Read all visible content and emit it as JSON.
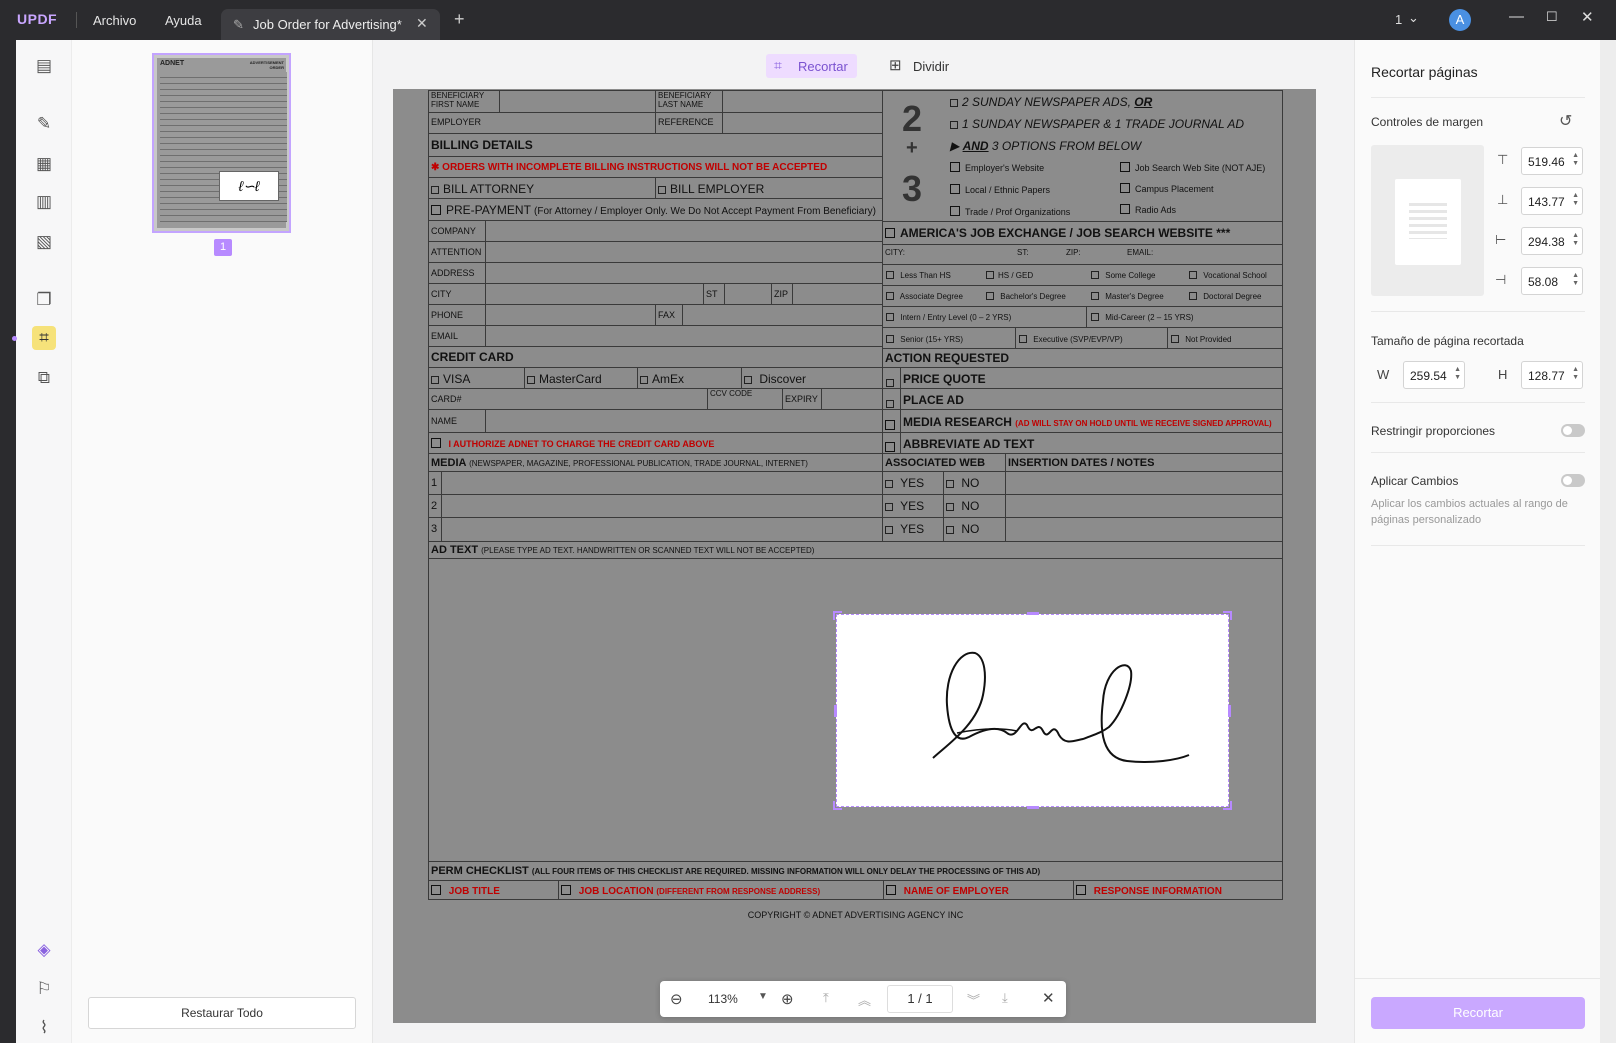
{
  "app": {
    "logo": "UPDF",
    "menu_file": "Archivo",
    "menu_help": "Ayuda",
    "tab_title": "Job Order for Advertising*",
    "page_indicator": "1",
    "avatar": "A"
  },
  "toolbar": {
    "crop_label": "Recortar",
    "split_label": "Dividir"
  },
  "thumbs": {
    "page_number": "1",
    "restore_all": "Restaurar Todo"
  },
  "right": {
    "title": "Recortar páginas",
    "margin_controls": "Controles de margen",
    "top": "519.46",
    "bottom": "143.77",
    "left": "294.38",
    "right": "58.08",
    "size_title": "Tamaño de página recortada",
    "w_label": "W",
    "w_value": "259.54",
    "h_label": "H",
    "h_value": "128.77",
    "lock_ratio": "Restringir proporciones",
    "apply_changes": "Aplicar Cambios",
    "apply_desc": "Aplicar los cambios actuales al rango de páginas personalizado",
    "crop_button": "Recortar"
  },
  "zoombar": {
    "zoom": "113%",
    "page": "1 / 1"
  },
  "form": {
    "beneficiary_first": "BENEFICIARY FIRST NAME",
    "beneficiary_last": "BENEFICIARY LAST NAME",
    "employer": "EMPLOYER",
    "reference": "REFERENCE",
    "billing_details": "BILLING DETAILS",
    "billing_warning": "ORDERS WITH INCOMPLETE BILLING INSTRUCTIONS WILL NOT BE ACCEPTED",
    "bill_attorney": "BILL ATTORNEY",
    "bill_employer": "BILL EMPLOYER",
    "prepayment": "PRE-PAYMENT",
    "prepayment_note": "(For Attorney / Employer Only. We Do Not Accept Payment From Beneficiary)",
    "company": "COMPANY",
    "attention": "ATTENTION",
    "address": "ADDRESS",
    "city": "CITY",
    "st": "ST",
    "zip": "ZIP",
    "phone": "PHONE",
    "fax": "FAX",
    "email": "EMAIL",
    "credit_card": "CREDIT CARD",
    "visa": "VISA",
    "mastercard": "MasterCard",
    "amex": "AmEx",
    "discover": "Discover",
    "card_no": "CARD#",
    "ccv": "CCV CODE",
    "expiry": "EXPIRY",
    "name": "NAME",
    "authorize": "I AUTHORIZE ADNET TO CHARGE THE CREDIT CARD ABOVE",
    "media": "MEDIA",
    "media_note": "(NEWSPAPER, MAGAZINE, PROFESSIONAL PUBLICATION, TRADE JOURNAL, INTERNET)",
    "row1": "1",
    "row2": "2",
    "row3": "3",
    "ad_text": "AD TEXT",
    "ad_text_note": "(PLEASE TYPE AD TEXT. HANDWRITTEN OR SCANNED TEXT WILL NOT BE ACCEPTED)",
    "big2": "2",
    "plus": "+",
    "big3": "3",
    "opt_sunday": "2 SUNDAY NEWSPAPER ADS,",
    "opt_or": "OR",
    "opt_sunday_trade": "1 SUNDAY NEWSPAPER & 1 TRADE JOURNAL AD",
    "opt_and": "AND",
    "opt_three": "3 OPTIONS FROM BELOW",
    "employers_website": "Employer's Website",
    "job_search": "Job Search Web Site (NOT AJE)",
    "local_ethnic": "Local / Ethnic Papers",
    "campus": "Campus Placement",
    "trade_prof": "Trade / Prof Organizations",
    "radio": "Radio Ads",
    "aje": "AMERICA'S JOB EXCHANGE / JOB SEARCH WEBSITE ***",
    "aje_city": "CITY:",
    "aje_st": "ST:",
    "aje_zip": "ZIP:",
    "aje_email": "EMAIL:",
    "less_hs": "Less Than HS",
    "hs_ged": "HS / GED",
    "some_college": "Some College",
    "vocational": "Vocational School",
    "associate": "Associate Degree",
    "bachelor": "Bachelor's Degree",
    "master": "Master's Degree",
    "doctoral": "Doctoral Degree",
    "intern": "Intern / Entry Level (0 – 2 YRS)",
    "mid": "Mid-Career (2 – 15 YRS)",
    "senior": "Senior (15+ YRS)",
    "executive": "Executive (SVP/EVP/VP)",
    "not_provided": "Not Provided",
    "action": "ACTION REQUESTED",
    "price_quote": "PRICE QUOTE",
    "place_ad": "PLACE AD",
    "media_research": "MEDIA RESEARCH",
    "media_research_note": "(AD WILL STAY ON HOLD UNTIL WE RECEIVE SIGNED APPROVAL)",
    "abbreviate": "ABBREVIATE AD TEXT",
    "assoc_web": "ASSOCIATED WEB",
    "insertion": "INSERTION DATES / NOTES",
    "yes": "YES",
    "no": "NO",
    "perm": "PERM CHECKLIST",
    "perm_note": "(ALL FOUR ITEMS OF THIS CHECKLIST ARE REQUIRED. MISSING INFORMATION WILL ONLY DELAY THE PROCESSING OF THIS AD)",
    "job_title": "JOB TITLE",
    "job_location": "JOB LOCATION",
    "job_location_note": "(DIFFERENT FROM RESPONSE ADDRESS)",
    "name_employer": "NAME OF EMPLOYER",
    "response_info": "RESPONSE INFORMATION",
    "copyright": "COPYRIGHT © ADNET ADVERTISING AGENCY INC"
  },
  "thumb_text": {
    "brand": "ADNET",
    "heading": "ADVERTISEMENT ORDER"
  },
  "colors": {
    "accent": "#b78aff",
    "crop_button_bg": "#c9a8ff",
    "titlebar": "#2b2b2e"
  }
}
